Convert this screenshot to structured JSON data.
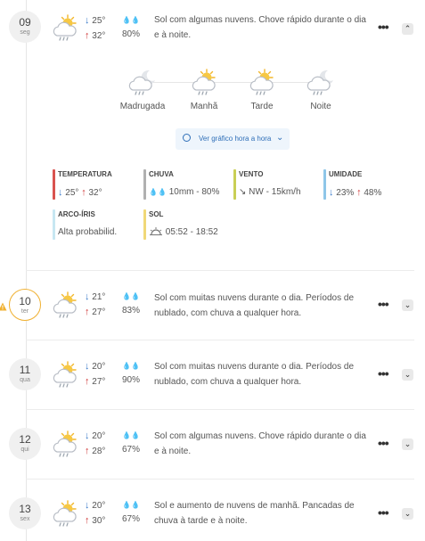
{
  "days": [
    {
      "day": "09",
      "dow": "seg",
      "min": "25°",
      "max": "32°",
      "rain": "80%",
      "desc": "Sol com algumas nuvens. Chove rápido durante o dia e à noite.",
      "chevron": "up"
    },
    {
      "day": "10",
      "dow": "ter",
      "min": "21°",
      "max": "27°",
      "rain": "83%",
      "desc": "Sol com muitas nuvens durante o dia. Períodos de nublado, com chuva a qualquer hora.",
      "chevron": "down"
    },
    {
      "day": "11",
      "dow": "qua",
      "min": "20°",
      "max": "27°",
      "rain": "90%",
      "desc": "Sol com muitas nuvens durante o dia. Períodos de nublado, com chuva a qualquer hora.",
      "chevron": "down"
    },
    {
      "day": "12",
      "dow": "qui",
      "min": "20°",
      "max": "28°",
      "rain": "67%",
      "desc": "Sol com algumas nuvens. Chove rápido durante o dia e à noite.",
      "chevron": "down"
    },
    {
      "day": "13",
      "dow": "sex",
      "min": "20°",
      "max": "30°",
      "rain": "67%",
      "desc": "Sol e aumento de nuvens de manhã. Pancadas de chuva à tarde e à noite.",
      "chevron": "down"
    }
  ],
  "periods": [
    "Madrugada",
    "Manhã",
    "Tarde",
    "Noite"
  ],
  "hourly_link": "Ver gráfico hora a hora",
  "stats": {
    "temperatura": {
      "title": "TEMPERATURA",
      "min": "25°",
      "max": "32°",
      "color": "#d9534f"
    },
    "chuva": {
      "title": "CHUVA",
      "value": "10mm - 80%",
      "color": "#b0b0b0"
    },
    "vento": {
      "title": "VENTO",
      "value": "NW - 15km/h",
      "color": "#c9cf55"
    },
    "umidade": {
      "title": "UMIDADE",
      "min": "23%",
      "max": "48%",
      "color": "#8ec6e8"
    },
    "arco_iris": {
      "title": "ARCO-ÍRIS",
      "value": "Alta probabilid.",
      "color": "#c7e7f2"
    },
    "sol": {
      "title": "SOL",
      "value": "05:52 - 18:52",
      "color": "#f0d878"
    }
  },
  "colors": {
    "accent": "#2f6fb8",
    "warning": "#f0b030",
    "drop": "#4a8fd8"
  }
}
